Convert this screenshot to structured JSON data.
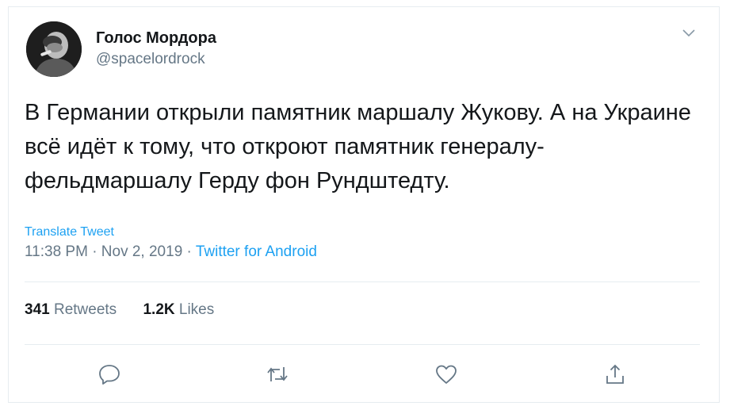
{
  "tweet": {
    "author_name": "Голос Мордора",
    "author_handle": "@spacelordrock",
    "text": "В Германии открыли памятник маршалу Жукову. А на Украине всё идёт к тому, что откроют памятник генералу-фельдмаршалу Герду фон Рундштедту.",
    "translate_label": "Translate Tweet",
    "time": "11:38 PM · Nov 2, 2019 · ",
    "source": "Twitter for Android",
    "retweets_count": "341",
    "retweets_label": "Retweets",
    "likes_count": "1.2K",
    "likes_label": "Likes"
  },
  "icons": {
    "more": "chevron-down-icon",
    "reply": "reply-icon",
    "retweet": "retweet-icon",
    "like": "heart-icon",
    "share": "share-icon"
  },
  "colors": {
    "link": "#1da1f2",
    "secondary_text": "#657786",
    "primary_text": "#14171a",
    "border": "#e6ecf0"
  }
}
